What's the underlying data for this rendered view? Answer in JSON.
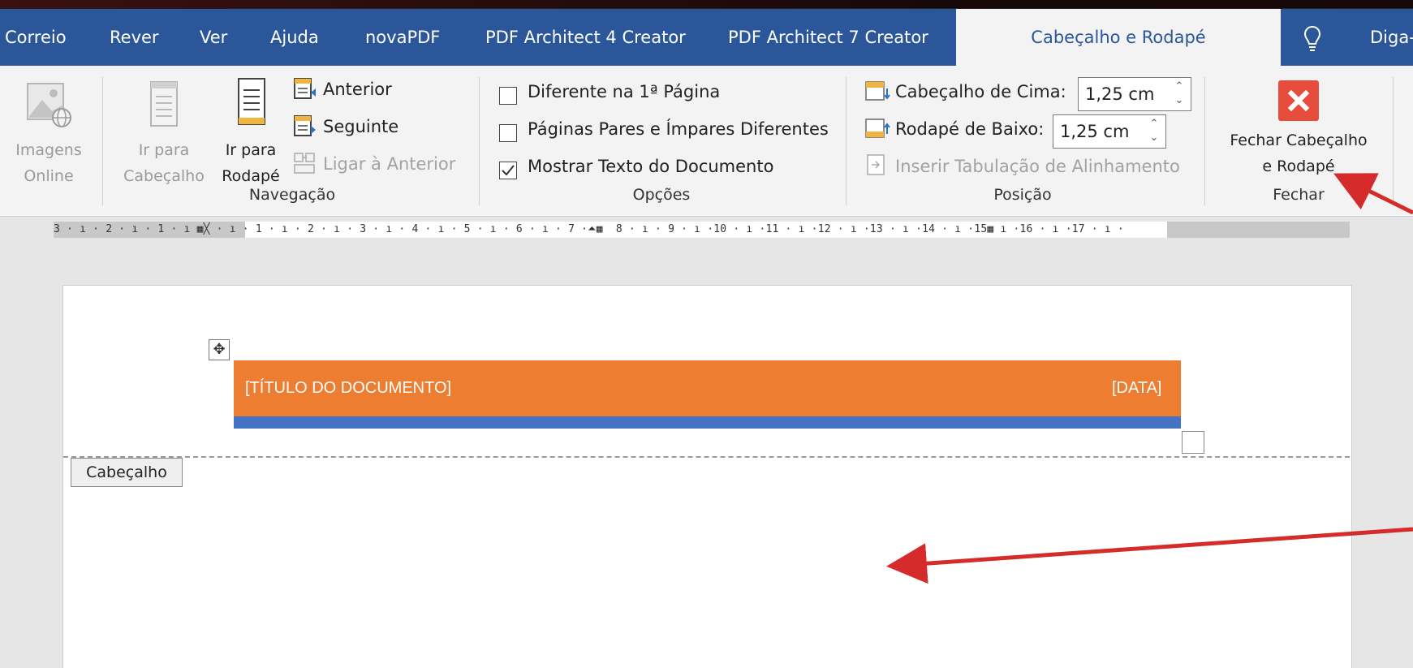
{
  "tabs": [
    {
      "label": "Correio"
    },
    {
      "label": "Rever"
    },
    {
      "label": "Ver"
    },
    {
      "label": "Ajuda"
    },
    {
      "label": "novaPDF"
    },
    {
      "label": "PDF Architect 4 Creator"
    },
    {
      "label": "PDF Architect 7 Creator"
    },
    {
      "label": "Cabeçalho e Rodapé"
    }
  ],
  "tell_me": "Diga-m",
  "ribbon": {
    "online_images": {
      "line1": "Imagens",
      "line2": "Online"
    },
    "navigation": {
      "goto_header": {
        "line1": "Ir para",
        "line2": "Cabeçalho"
      },
      "goto_footer": {
        "line1": "Ir para",
        "line2": "Rodapé"
      },
      "previous": "Anterior",
      "next": "Seguinte",
      "link_previous": "Ligar à Anterior",
      "group_label": "Navegação"
    },
    "options": {
      "different_first_page": "Diferente na 1ª Página",
      "different_odd_even": "Páginas Pares e Ímpares Diferentes",
      "show_document_text": "Mostrar Texto do Documento",
      "group_label": "Opções"
    },
    "position": {
      "header_from_top_label": "Cabeçalho de Cima:",
      "header_from_top_value": "1,25 cm",
      "footer_from_bottom_label": "Rodapé de Baixo:",
      "footer_from_bottom_value": "1,25 cm",
      "insert_alignment_tab": "Inserir Tabulação de Alinhamento",
      "group_label": "Posição"
    },
    "close": {
      "line1": "Fechar Cabeçalho",
      "line2": "e Rodapé",
      "group_label": "Fechar"
    }
  },
  "ruler_text": "3 · ı · 2 · ı · 1 · ı ▦╳ · ı · 1 · ı · 2 · ı · 3 · ı · 4 · ı · 5 · ı · 6 · ı · 7 ·⏶▦  8 · ı · 9 · ı ·10 · ı ·11 · ı ·12 · ı ·13 · ı ·14 · ı ·15▦ ı ·16 · ı ·17 · ı ·",
  "document": {
    "title_placeholder": "[TÍTULO DO DOCUMENTO]",
    "date_placeholder": "[DATA]",
    "header_tag": "Cabeçalho"
  },
  "colors": {
    "tab_bar": "#2b579a",
    "header_band": "#ed7d31",
    "header_rule": "#4472c4",
    "close_button": "#e84c3d",
    "annotation_arrow": "#d62b2b"
  },
  "checkbox_states": {
    "different_first_page": false,
    "different_odd_even": false,
    "show_document_text": true
  }
}
